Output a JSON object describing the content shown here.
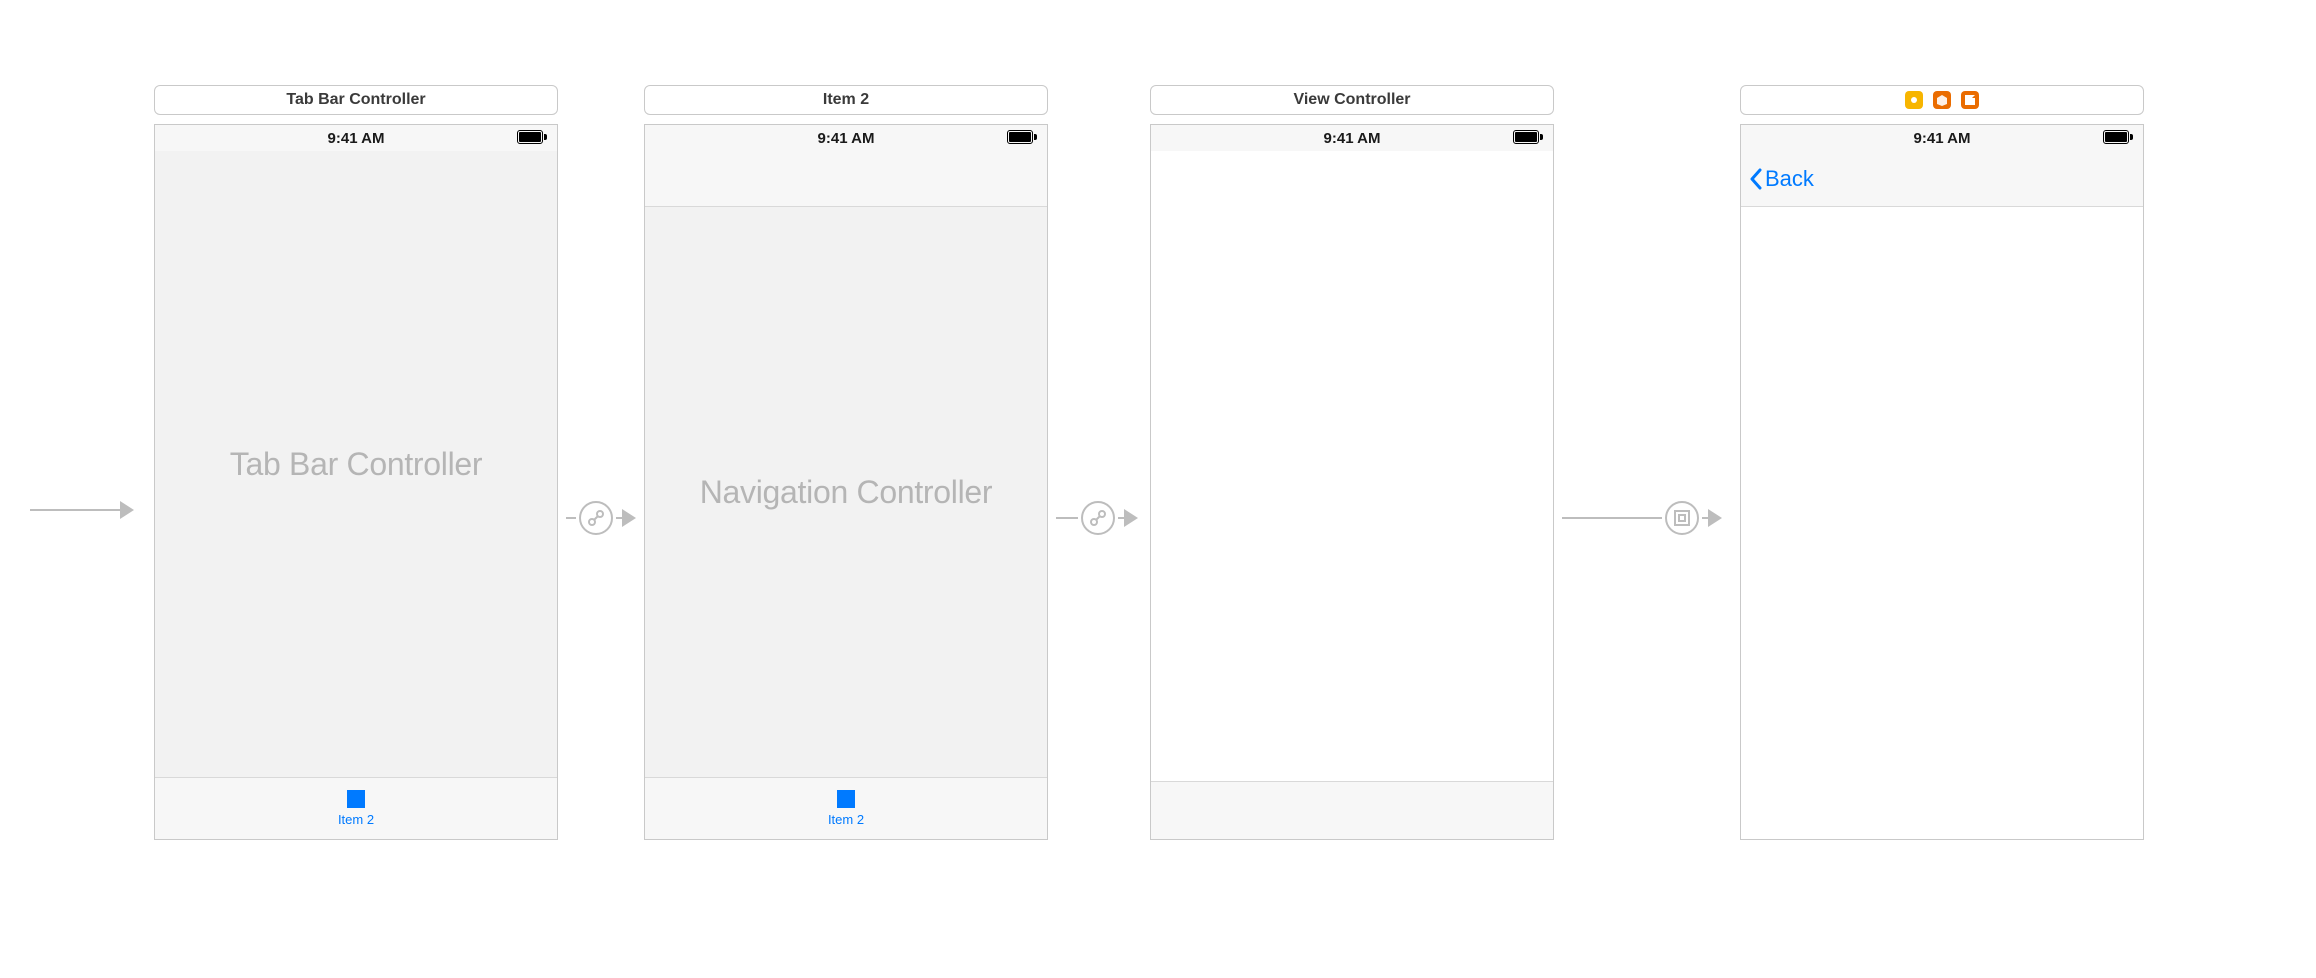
{
  "scene1": {
    "title": "Tab Bar Controller",
    "time": "9:41 AM",
    "placeholder": "Tab Bar Controller",
    "tab_label": "Item 2"
  },
  "scene2": {
    "title": "Item 2",
    "time": "9:41 AM",
    "placeholder": "Navigation Controller",
    "tab_label": "Item 2"
  },
  "scene3": {
    "title": "View Controller",
    "time": "9:41 AM"
  },
  "scene4": {
    "time": "9:41 AM",
    "back_label": "Back"
  }
}
